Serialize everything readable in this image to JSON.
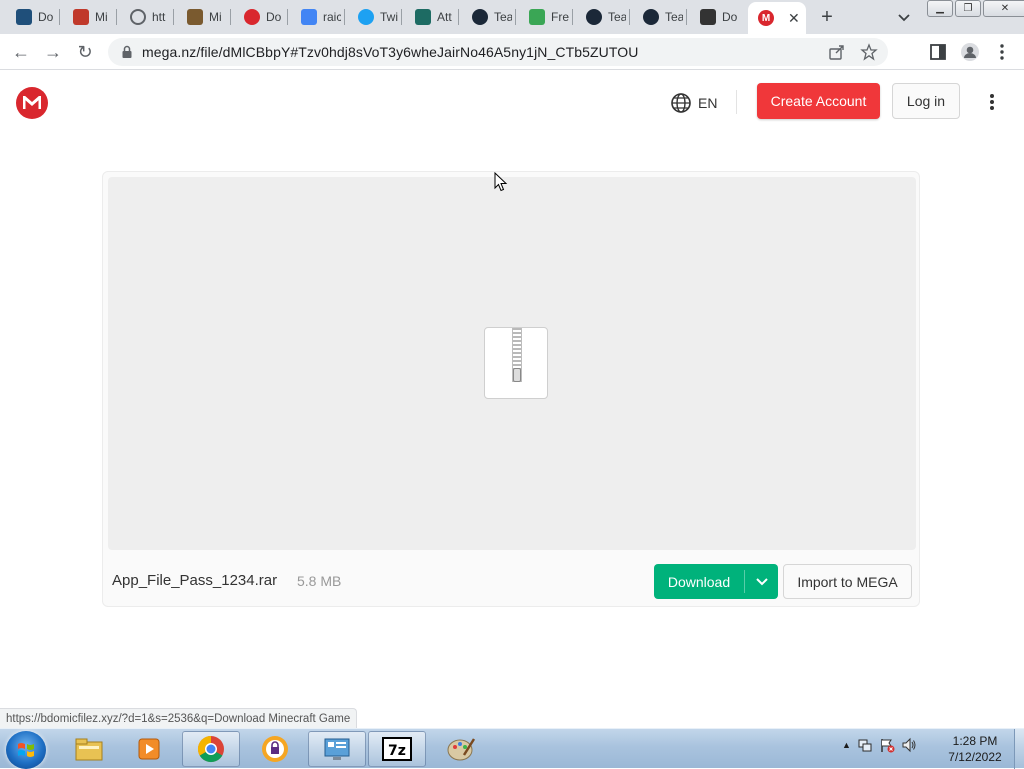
{
  "browser": {
    "tabs": [
      {
        "title": "Do",
        "icon": "site-icon",
        "color": "#1f4f7a"
      },
      {
        "title": "Mi",
        "icon": "gamepad-icon",
        "color": "#c0392b"
      },
      {
        "title": "htt",
        "icon": "globe-icon",
        "color": "#5f6368"
      },
      {
        "title": "Mi",
        "icon": "site-icon",
        "color": "#7a5a2f"
      },
      {
        "title": "Do",
        "icon": "mega-icon",
        "color": "#d9272e"
      },
      {
        "title": "raic",
        "icon": "google-icon",
        "color": "#4285f4"
      },
      {
        "title": "Twi",
        "icon": "twitter-icon",
        "color": "#1da1f2"
      },
      {
        "title": "Att",
        "icon": "site-icon",
        "color": "#1d6b63"
      },
      {
        "title": "Tea",
        "icon": "steam-icon",
        "color": "#1b2838"
      },
      {
        "title": "Fre",
        "icon": "clover-icon",
        "color": "#3aa655"
      },
      {
        "title": "Tea",
        "icon": "steam-icon",
        "color": "#1b2838"
      },
      {
        "title": "Tea",
        "icon": "steam-icon",
        "color": "#1b2838"
      },
      {
        "title": "Do",
        "icon": "site-icon",
        "color": "#333333"
      }
    ],
    "active_tab": {
      "icon": "mega-icon",
      "color": "#d9272e"
    },
    "url": "mega.nz/file/dMlCBbpY#Tzv0hdj8sVoT3y6wheJairNo46A5ny1jN_CTb5ZUTOU",
    "status_text": "https://bdomicfilez.xyz/?d=1&s=2536&q=Download Minecraft Game"
  },
  "header": {
    "language": "EN",
    "create_account": "Create Account",
    "login": "Log in"
  },
  "file": {
    "name": "App_File_Pass_1234.rar",
    "size": "5.8 MB",
    "download_label": "Download",
    "import_label": "Import to MEGA"
  },
  "taskbar": {
    "time": "1:28 PM",
    "date": "7/12/2022"
  },
  "colors": {
    "mega_red": "#d9272e",
    "create_button": "#f0373a",
    "download_green": "#00b27b"
  }
}
